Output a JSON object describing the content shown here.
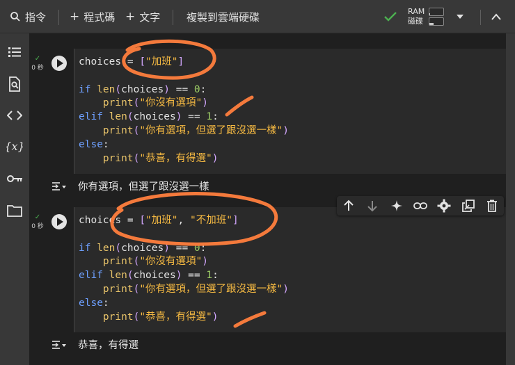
{
  "toolbar": {
    "command_label": "指令",
    "add_code_label": "程式碼",
    "add_text_label": "文字",
    "copy_to_drive_label": "複製到雲端硬碟",
    "ram_label": "RAM",
    "disk_label": "磁碟"
  },
  "cells": [
    {
      "status_time": "0 秒",
      "code_lines": [
        [
          {
            "t": "choices = ",
            "c": "plain"
          },
          {
            "t": "[",
            "c": "br"
          },
          {
            "t": "\"加班\"",
            "c": "str"
          },
          {
            "t": "]",
            "c": "br"
          }
        ],
        [],
        [
          {
            "t": "if ",
            "c": "kw"
          },
          {
            "t": "len",
            "c": "fn"
          },
          {
            "t": "(",
            "c": "br"
          },
          {
            "t": "choices",
            "c": "plain"
          },
          {
            "t": ")",
            "c": "br"
          },
          {
            "t": " == ",
            "c": "op"
          },
          {
            "t": "0",
            "c": "num"
          },
          {
            "t": ":",
            "c": "plain"
          }
        ],
        [
          {
            "t": "    ",
            "c": "plain"
          },
          {
            "t": "print",
            "c": "fn"
          },
          {
            "t": "(",
            "c": "br"
          },
          {
            "t": "\"你沒有選項\"",
            "c": "str"
          },
          {
            "t": ")",
            "c": "br"
          }
        ],
        [
          {
            "t": "elif ",
            "c": "kw"
          },
          {
            "t": "len",
            "c": "fn"
          },
          {
            "t": "(",
            "c": "br"
          },
          {
            "t": "choices",
            "c": "plain"
          },
          {
            "t": ")",
            "c": "br"
          },
          {
            "t": " == ",
            "c": "op"
          },
          {
            "t": "1",
            "c": "num"
          },
          {
            "t": ":",
            "c": "plain"
          }
        ],
        [
          {
            "t": "    ",
            "c": "plain"
          },
          {
            "t": "print",
            "c": "fn"
          },
          {
            "t": "(",
            "c": "br"
          },
          {
            "t": "\"你有選項，但選了跟沒選一樣\"",
            "c": "str"
          },
          {
            "t": ")",
            "c": "br"
          }
        ],
        [
          {
            "t": "else",
            "c": "kw"
          },
          {
            "t": ":",
            "c": "plain"
          }
        ],
        [
          {
            "t": "    ",
            "c": "plain"
          },
          {
            "t": "print",
            "c": "fn"
          },
          {
            "t": "(",
            "c": "br"
          },
          {
            "t": "\"恭喜，有得選\"",
            "c": "str"
          },
          {
            "t": ")",
            "c": "br"
          }
        ]
      ],
      "output": "你有選項，但選了跟沒選一樣"
    },
    {
      "status_time": "0 秒",
      "code_lines": [
        [
          {
            "t": "choices = ",
            "c": "plain"
          },
          {
            "t": "[",
            "c": "br"
          },
          {
            "t": "\"加班\"",
            "c": "str"
          },
          {
            "t": ", ",
            "c": "plain"
          },
          {
            "t": "\"不加班\"",
            "c": "str"
          },
          {
            "t": "]",
            "c": "br"
          }
        ],
        [],
        [
          {
            "t": "if ",
            "c": "kw"
          },
          {
            "t": "len",
            "c": "fn"
          },
          {
            "t": "(",
            "c": "br"
          },
          {
            "t": "choices",
            "c": "plain"
          },
          {
            "t": ")",
            "c": "br"
          },
          {
            "t": " == ",
            "c": "op"
          },
          {
            "t": "0",
            "c": "num"
          },
          {
            "t": ":",
            "c": "plain"
          }
        ],
        [
          {
            "t": "    ",
            "c": "plain"
          },
          {
            "t": "print",
            "c": "fn"
          },
          {
            "t": "(",
            "c": "br"
          },
          {
            "t": "\"你沒有選項\"",
            "c": "str"
          },
          {
            "t": ")",
            "c": "br"
          }
        ],
        [
          {
            "t": "elif ",
            "c": "kw"
          },
          {
            "t": "len",
            "c": "fn"
          },
          {
            "t": "(",
            "c": "br"
          },
          {
            "t": "choices",
            "c": "plain"
          },
          {
            "t": ")",
            "c": "br"
          },
          {
            "t": " == ",
            "c": "op"
          },
          {
            "t": "1",
            "c": "num"
          },
          {
            "t": ":",
            "c": "plain"
          }
        ],
        [
          {
            "t": "    ",
            "c": "plain"
          },
          {
            "t": "print",
            "c": "fn"
          },
          {
            "t": "(",
            "c": "br"
          },
          {
            "t": "\"你有選項，但選了跟沒選一樣\"",
            "c": "str"
          },
          {
            "t": ")",
            "c": "br"
          }
        ],
        [
          {
            "t": "else",
            "c": "kw"
          },
          {
            "t": ":",
            "c": "plain"
          }
        ],
        [
          {
            "t": "    ",
            "c": "plain"
          },
          {
            "t": "print",
            "c": "fn"
          },
          {
            "t": "(",
            "c": "br"
          },
          {
            "t": "\"恭喜，有得選\"",
            "c": "str"
          },
          {
            "t": ")",
            "c": "br"
          }
        ]
      ],
      "output": "恭喜，有得選"
    }
  ],
  "colors": {
    "accent_annotation": "#f47a3c",
    "check_green": "#4caf50"
  },
  "usage": {
    "ram_fraction": 0.05,
    "disk_fraction": 0.3
  }
}
